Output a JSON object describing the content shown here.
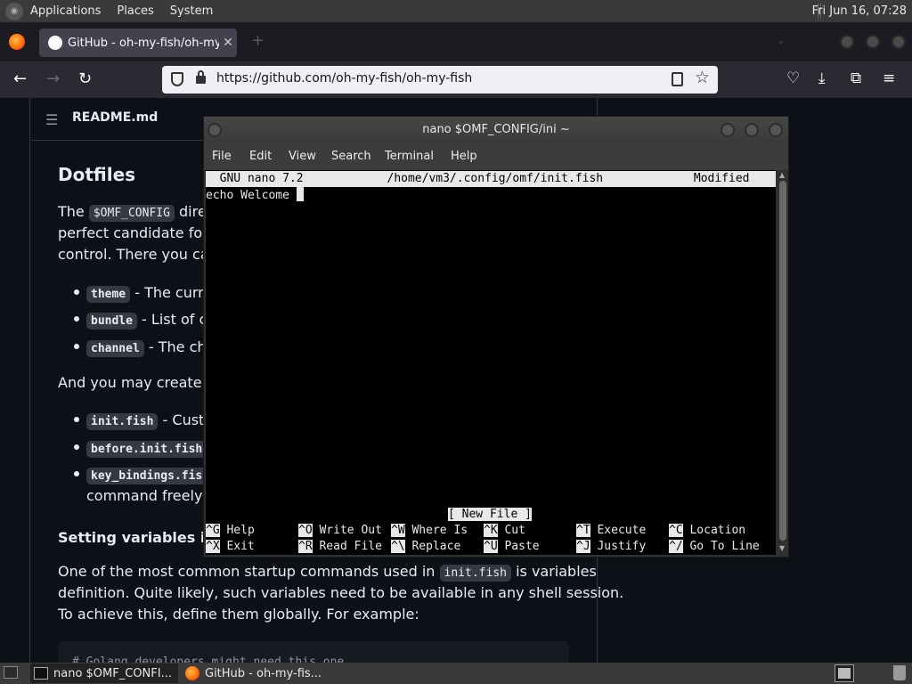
{
  "top_panel": {
    "menus": [
      "Applications",
      "Places",
      "System"
    ],
    "clock": "Fri Jun 16, 07:28"
  },
  "browser": {
    "tab_title": "GitHub - oh-my-fish/oh-my",
    "url": "https://github.com/oh-my-fish/oh-my-fish"
  },
  "readme": {
    "header": "README.md",
    "heading": "Dotfiles",
    "p1_before": "The ",
    "p1_code": "$OMF_CONFIG",
    "p1_after": " dire",
    "p1_line2": "perfect candidate for be",
    "p1_line3": "control. There you can",
    "bullets1": [
      {
        "code": "theme",
        "text": " - The curre"
      },
      {
        "code": "bundle",
        "text": " - List of c"
      },
      {
        "code": "channel",
        "text": " - The ch"
      }
    ],
    "p2": "And you may create an",
    "bullets2": [
      {
        "code": "init.fish",
        "text": " - Cust"
      },
      {
        "code": "before.init.fish",
        "text": ""
      },
      {
        "code": "key_bindings.fis",
        "text": ""
      }
    ],
    "bullet_cont": "command freely",
    "subheading": "Setting variables in",
    "subheading_code": "i",
    "p3_l1_before": "One of the most common startup commands used in ",
    "p3_l1_code": "init.fish",
    "p3_l1_after": " is variables",
    "p3_l2": "definition. Quite likely, such variables need to be available in any shell session.",
    "p3_l3": "To achieve this, define them globally. For example:",
    "codeblock": "# Golang developers might need this one"
  },
  "terminal": {
    "title": "nano $OMF_CONFIG/ini ~",
    "menu": [
      "File",
      "Edit",
      "View",
      "Search",
      "Terminal",
      "Help"
    ],
    "nano_header": "  GNU nano 7.2            /home/vm3/.config/omf/init.fish             Modified  ",
    "content_line": "echo Welcome ",
    "status": "[ New File ]",
    "shortcuts_row1": [
      {
        "key": "^G",
        "label": " Help      "
      },
      {
        "key": "^O",
        "label": " Write Out "
      },
      {
        "key": "^W",
        "label": " Where Is  "
      },
      {
        "key": "^K",
        "label": " Cut       "
      },
      {
        "key": "^T",
        "label": " Execute   "
      },
      {
        "key": "^C",
        "label": " Location"
      }
    ],
    "shortcuts_row2": [
      {
        "key": "^X",
        "label": " Exit      "
      },
      {
        "key": "^R",
        "label": " Read File "
      },
      {
        "key": "^\\",
        "label": " Replace   "
      },
      {
        "key": "^U",
        "label": " Paste     "
      },
      {
        "key": "^J",
        "label": " Justify   "
      },
      {
        "key": "^/",
        "label": " Go To Line"
      }
    ]
  },
  "taskbar": {
    "task1": "nano $OMF_CONFI...",
    "task2": "GitHub - oh-my-fis..."
  }
}
